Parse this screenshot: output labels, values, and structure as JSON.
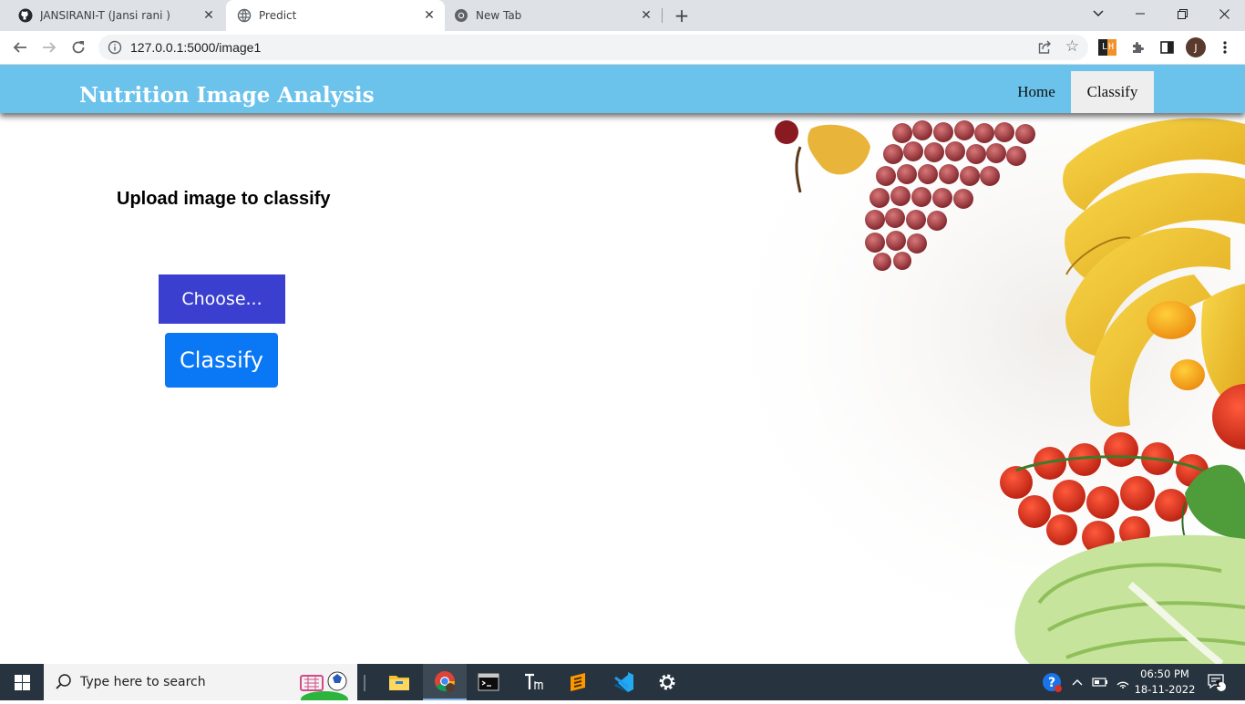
{
  "browser": {
    "tabs": [
      {
        "title": "JANSIRANI-T (Jansi rani )",
        "icon": "github-icon",
        "active": false
      },
      {
        "title": "Predict",
        "icon": "globe-icon",
        "active": true
      },
      {
        "title": "New Tab",
        "icon": "chrome-icon",
        "active": false
      }
    ],
    "close_glyph": "✕",
    "newtab_glyph": "+",
    "url": "127.0.0.1:5000/image1",
    "profile_initial": "J",
    "extension_label": "LH"
  },
  "navbar": {
    "brand": "Nutrition Image Analysis",
    "links": [
      {
        "label": "Home",
        "active": false
      },
      {
        "label": "Classify",
        "active": true
      }
    ],
    "color": "#6bc3ec"
  },
  "main": {
    "heading": "Upload image to classify",
    "choose_label": "Choose...",
    "classify_label": "Classify",
    "choose_color": "#3a3fcf",
    "classify_color": "#0a77f5"
  },
  "taskbar": {
    "search_placeholder": "Type here to search",
    "time": "06:50 PM",
    "date": "18-11-2022",
    "notification_count": "1"
  }
}
